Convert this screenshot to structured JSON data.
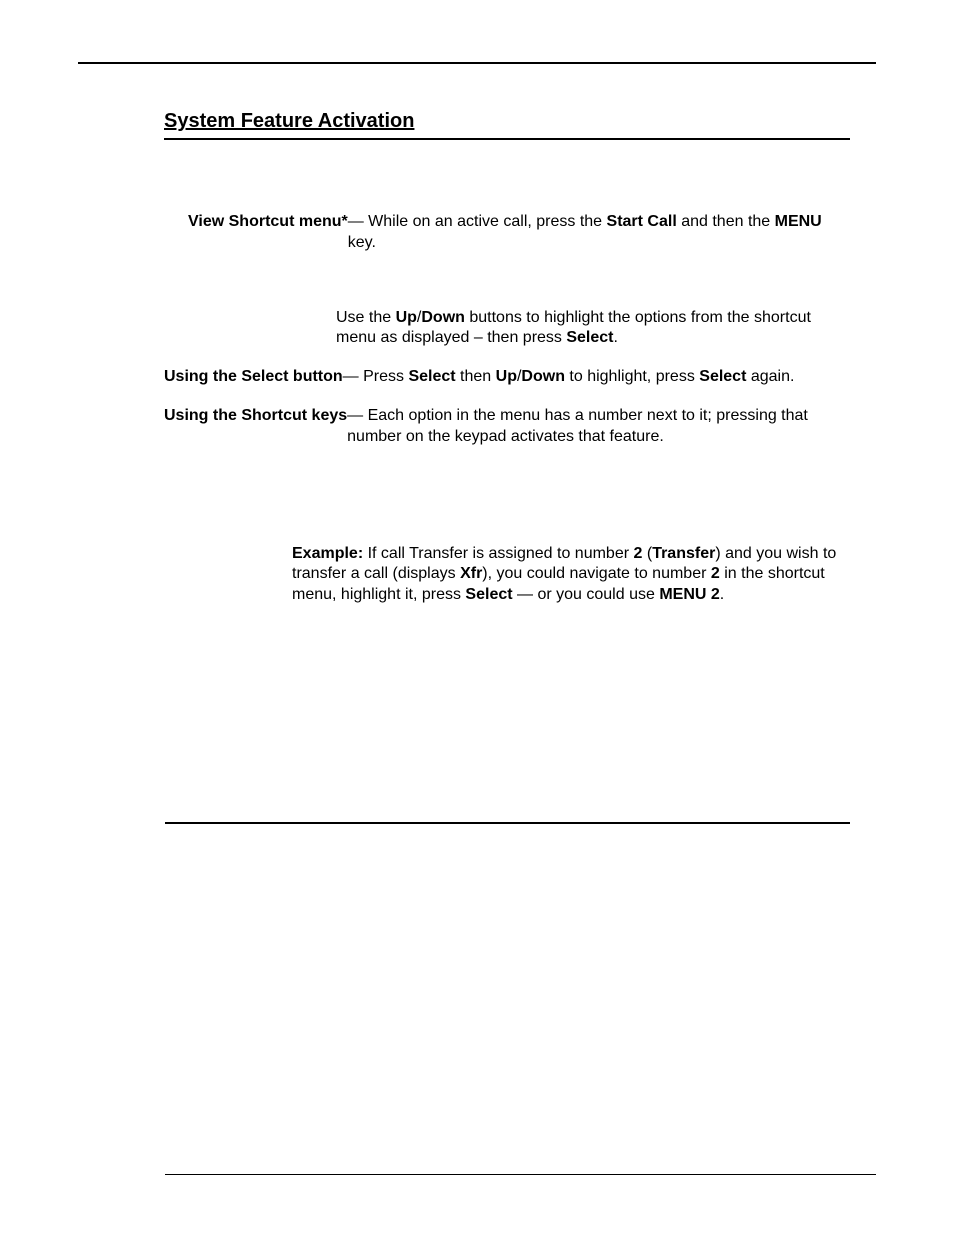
{
  "section_title": "System Feature Activation",
  "t1_label": "View Shortcut menu*",
  "t1_rest_a": " — While on an active call, press the ",
  "t1_rest_b": "Start Call",
  "t1_rest_c": " and then the ",
  "t1_rest_d": "MENU",
  "t1_rest_e": " key.",
  "t2_a": "Use the ",
  "t2_b": "Up",
  "t2_c": "/",
  "t2_d": "Down",
  "t2_e": " buttons to highlight the options from the shortcut menu as displayed – then press ",
  "t2_f": "Select",
  "t2_g": ".",
  "t3_label": "Using the Select button",
  "t3_a": " — Press ",
  "t3_b": "Select",
  "t3_c": " then ",
  "t3_d": "Up",
  "t3_e": "/",
  "t3_f": "Down",
  "t3_g": " to highlight, press ",
  "t3_h": "Select",
  "t3_i": " again.",
  "t4_label": "Using the Shortcut keys",
  "t4_a": " — Each option in the menu has a number next to it; pressing that number on the keypad activates that feature.",
  "t5_label": "Example:",
  "t5_a": " If call Transfer is assigned to number ",
  "t5_b": "2",
  "t5_c": " (",
  "t5_d": "Transfer",
  "t5_e": ") and you wish to transfer a call (displays ",
  "t5_f": "Xfr",
  "t5_g": "), you could navigate to number ",
  "t5_h": "2",
  "t5_i": " in the shortcut menu, highlight it, press ",
  "t5_j": "Select",
  "t5_k": " — or you could use ",
  "t5_l": "MENU",
  "t5_m": " ",
  "t5_n": "2",
  "t5_o": "."
}
